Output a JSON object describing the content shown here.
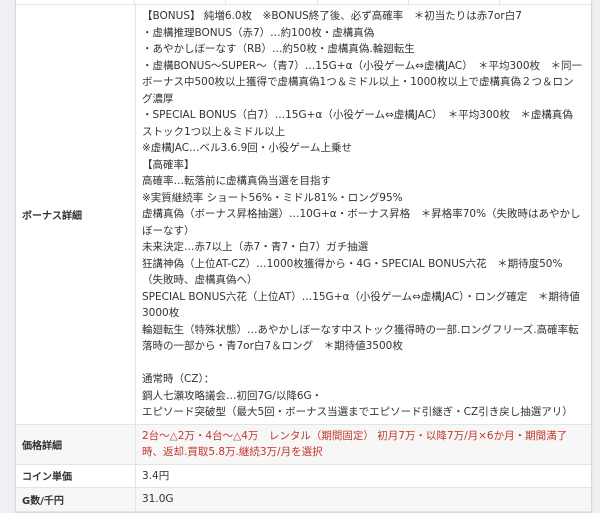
{
  "rows": [
    {
      "label": "ボーナス詳細",
      "lines": [
        "【BONUS】 純増6.0枚　※BONUS終了後、必ず高確率　＊初当たりは赤7or白7",
        "・虚構推理BONUS（赤7）…約100枚・虚構真偽",
        "・あやかしぼーなす（RB）…約50枚・虚構真偽.輪廻転生",
        "・虚構BONUS～SUPER～（青7）…15G+α（小役ゲーム⇔虚構JAC）　＊平均300枚　＊同一ボーナス中500枚以上獲得で虚構真偽1つ＆ミドル以上・1000枚以上で虚構真偽２つ＆ロング濃厚",
        "・SPECIAL BONUS（白7）…15G+α（小役ゲーム⇔虚構JAC）　＊平均300枚　＊虚構真偽ストック1つ以上＆ミドル以上",
        "※虚構JAC…ベル3.6.9回・小役ゲーム上乗せ",
        "【高確率】",
        "高確率…転落前に虚構真偽当選を目指す",
        "※実質継続率 ショート56%・ミドル81%・ロング95%",
        "虚構真偽（ボーナス昇格抽選）…10G+α・ボーナス昇格　＊昇格率70%（失敗時はあやかしぼーなす）",
        "未来決定…赤7以上（赤7・青7・白7）ガチ抽選",
        "狂講神偽（上位AT-CZ）…1000枚獲得から・4G・SPECIAL BONUS六花　＊期待度50%（失敗時、虚構真偽へ）",
        "SPECIAL BONUS六花（上位AT）…15G+α（小役ゲーム⇔虚構JAC）・ロング確定　＊期待値3000枚",
        "輪廻転生（特殊状態）…あやかしぼーなす中ストック獲得時の一部.ロングフリーズ.高確率転落時の一部から・青7or白7＆ロング　＊期待値3500枚",
        "",
        "通常時（CZ）：",
        "鋼人七瀬攻略議会…初回7G/以降6G・",
        "エピソード突破型（最大5回・ボーナス当選までエピソード引継ぎ・CZ引き戻し抽選アリ）"
      ]
    },
    {
      "label": "価格詳細",
      "value": "2台～△2万・4台～△4万　レンタル（期間固定） 初月7万・以降7万/月×6か月・期間満了時、返却.買取5.8万.継続3万/月を選択"
    },
    {
      "label": "コイン単価",
      "value": "3.4円"
    },
    {
      "label": "G数/千円",
      "value": "31.0G"
    }
  ],
  "colors": {
    "price_text": "#c0392b"
  }
}
